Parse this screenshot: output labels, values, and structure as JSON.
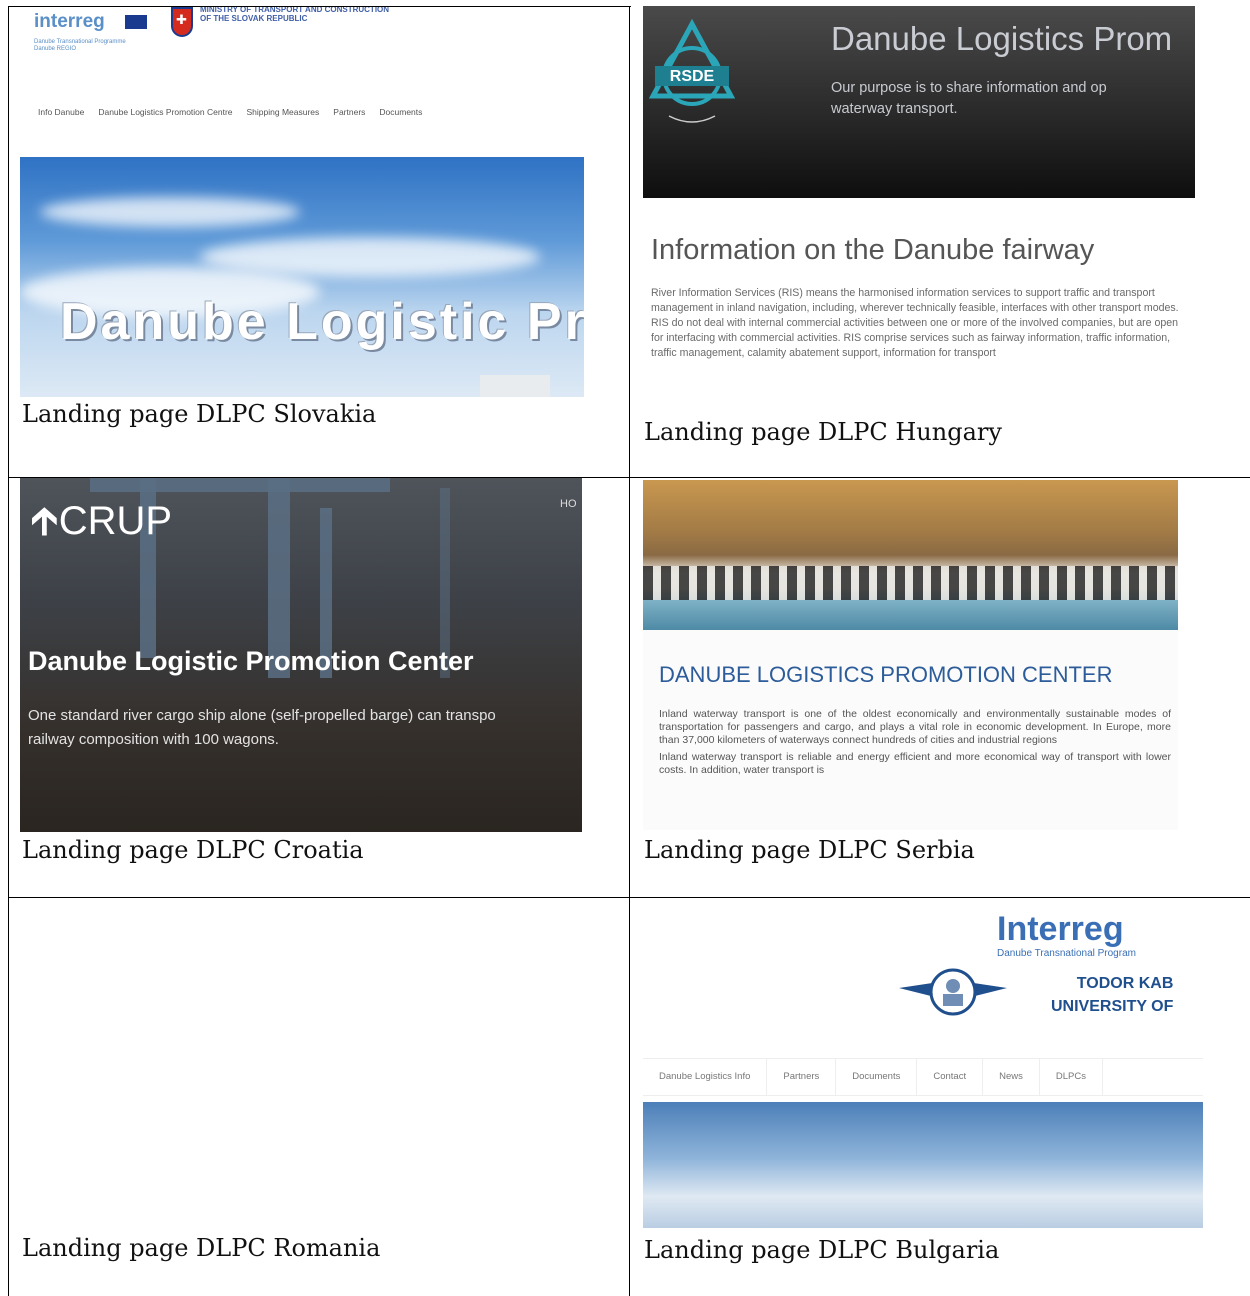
{
  "cells": {
    "slovakia": {
      "caption": "Landing page DLPC Slovakia",
      "logo": "interreg",
      "logo_sub": "Danube Transnational Programme Danube REGIO",
      "ministry": "MINISTRY OF TRANSPORT AND CONSTRUCTION OF THE SLOVAK REPUBLIC",
      "nav": [
        "Info Danube",
        "Danube Logistics Promotion Centre",
        "Shipping Measures",
        "Partners",
        "Documents"
      ],
      "hero_title": "Danube Logistic Pro"
    },
    "hungary": {
      "caption": "Landing page DLPC Hungary",
      "emblem_text": "RSDE",
      "banner_title": "Danube Logistics Prom",
      "banner_sub_1": "Our purpose is to share information and op",
      "banner_sub_2": "waterway transport.",
      "heading": "Information on the Danube fairway",
      "body": "River Information Services (RIS) means the harmonised information services to support traffic and transport management in inland navigation, including, wherever technically feasible, interfaces with other transport modes. RIS do not deal with internal commercial activities between one or more of the involved companies, but are open for interfacing with commercial activities. RIS comprise services such as fairway information, traffic information, traffic management, calamity abatement support, information for transport"
    },
    "croatia": {
      "caption": "Landing page DLPC Croatia",
      "logo": "CRUP",
      "nav_fragment": "HO",
      "title": "Danube Logistic Promotion Center",
      "body_1": "One standard river cargo ship alone (self-propelled barge) can transpo",
      "body_2": "railway composition with 100 wagons."
    },
    "serbia": {
      "caption": "Landing page DLPC Serbia",
      "title": "DANUBE LOGISTICS PROMOTION CENTER",
      "body_1": "Inland waterway transport is one of the oldest economically and environmentally sustainable modes of transportation for passengers and cargo, and plays a vital role in economic development. In Europe, more than 37,000 kilometers of waterways connect hundreds of cities and industrial regions",
      "body_2": "Inland waterway transport is reliable and energy efficient and more economical way of transport with lower costs. In addition, water transport is"
    },
    "romania": {
      "caption": "Landing page DLPC Romania"
    },
    "bulgaria": {
      "caption": "Landing page DLPC Bulgaria",
      "logo": "Interreg",
      "logo_sub": "Danube Transnational Program",
      "uni_line_1": "TODOR KAB",
      "uni_line_2": "UNIVERSITY OF",
      "nav": [
        "Danube Logistics Info",
        "Partners",
        "Documents",
        "Contact",
        "News",
        "DLPCs"
      ]
    }
  }
}
